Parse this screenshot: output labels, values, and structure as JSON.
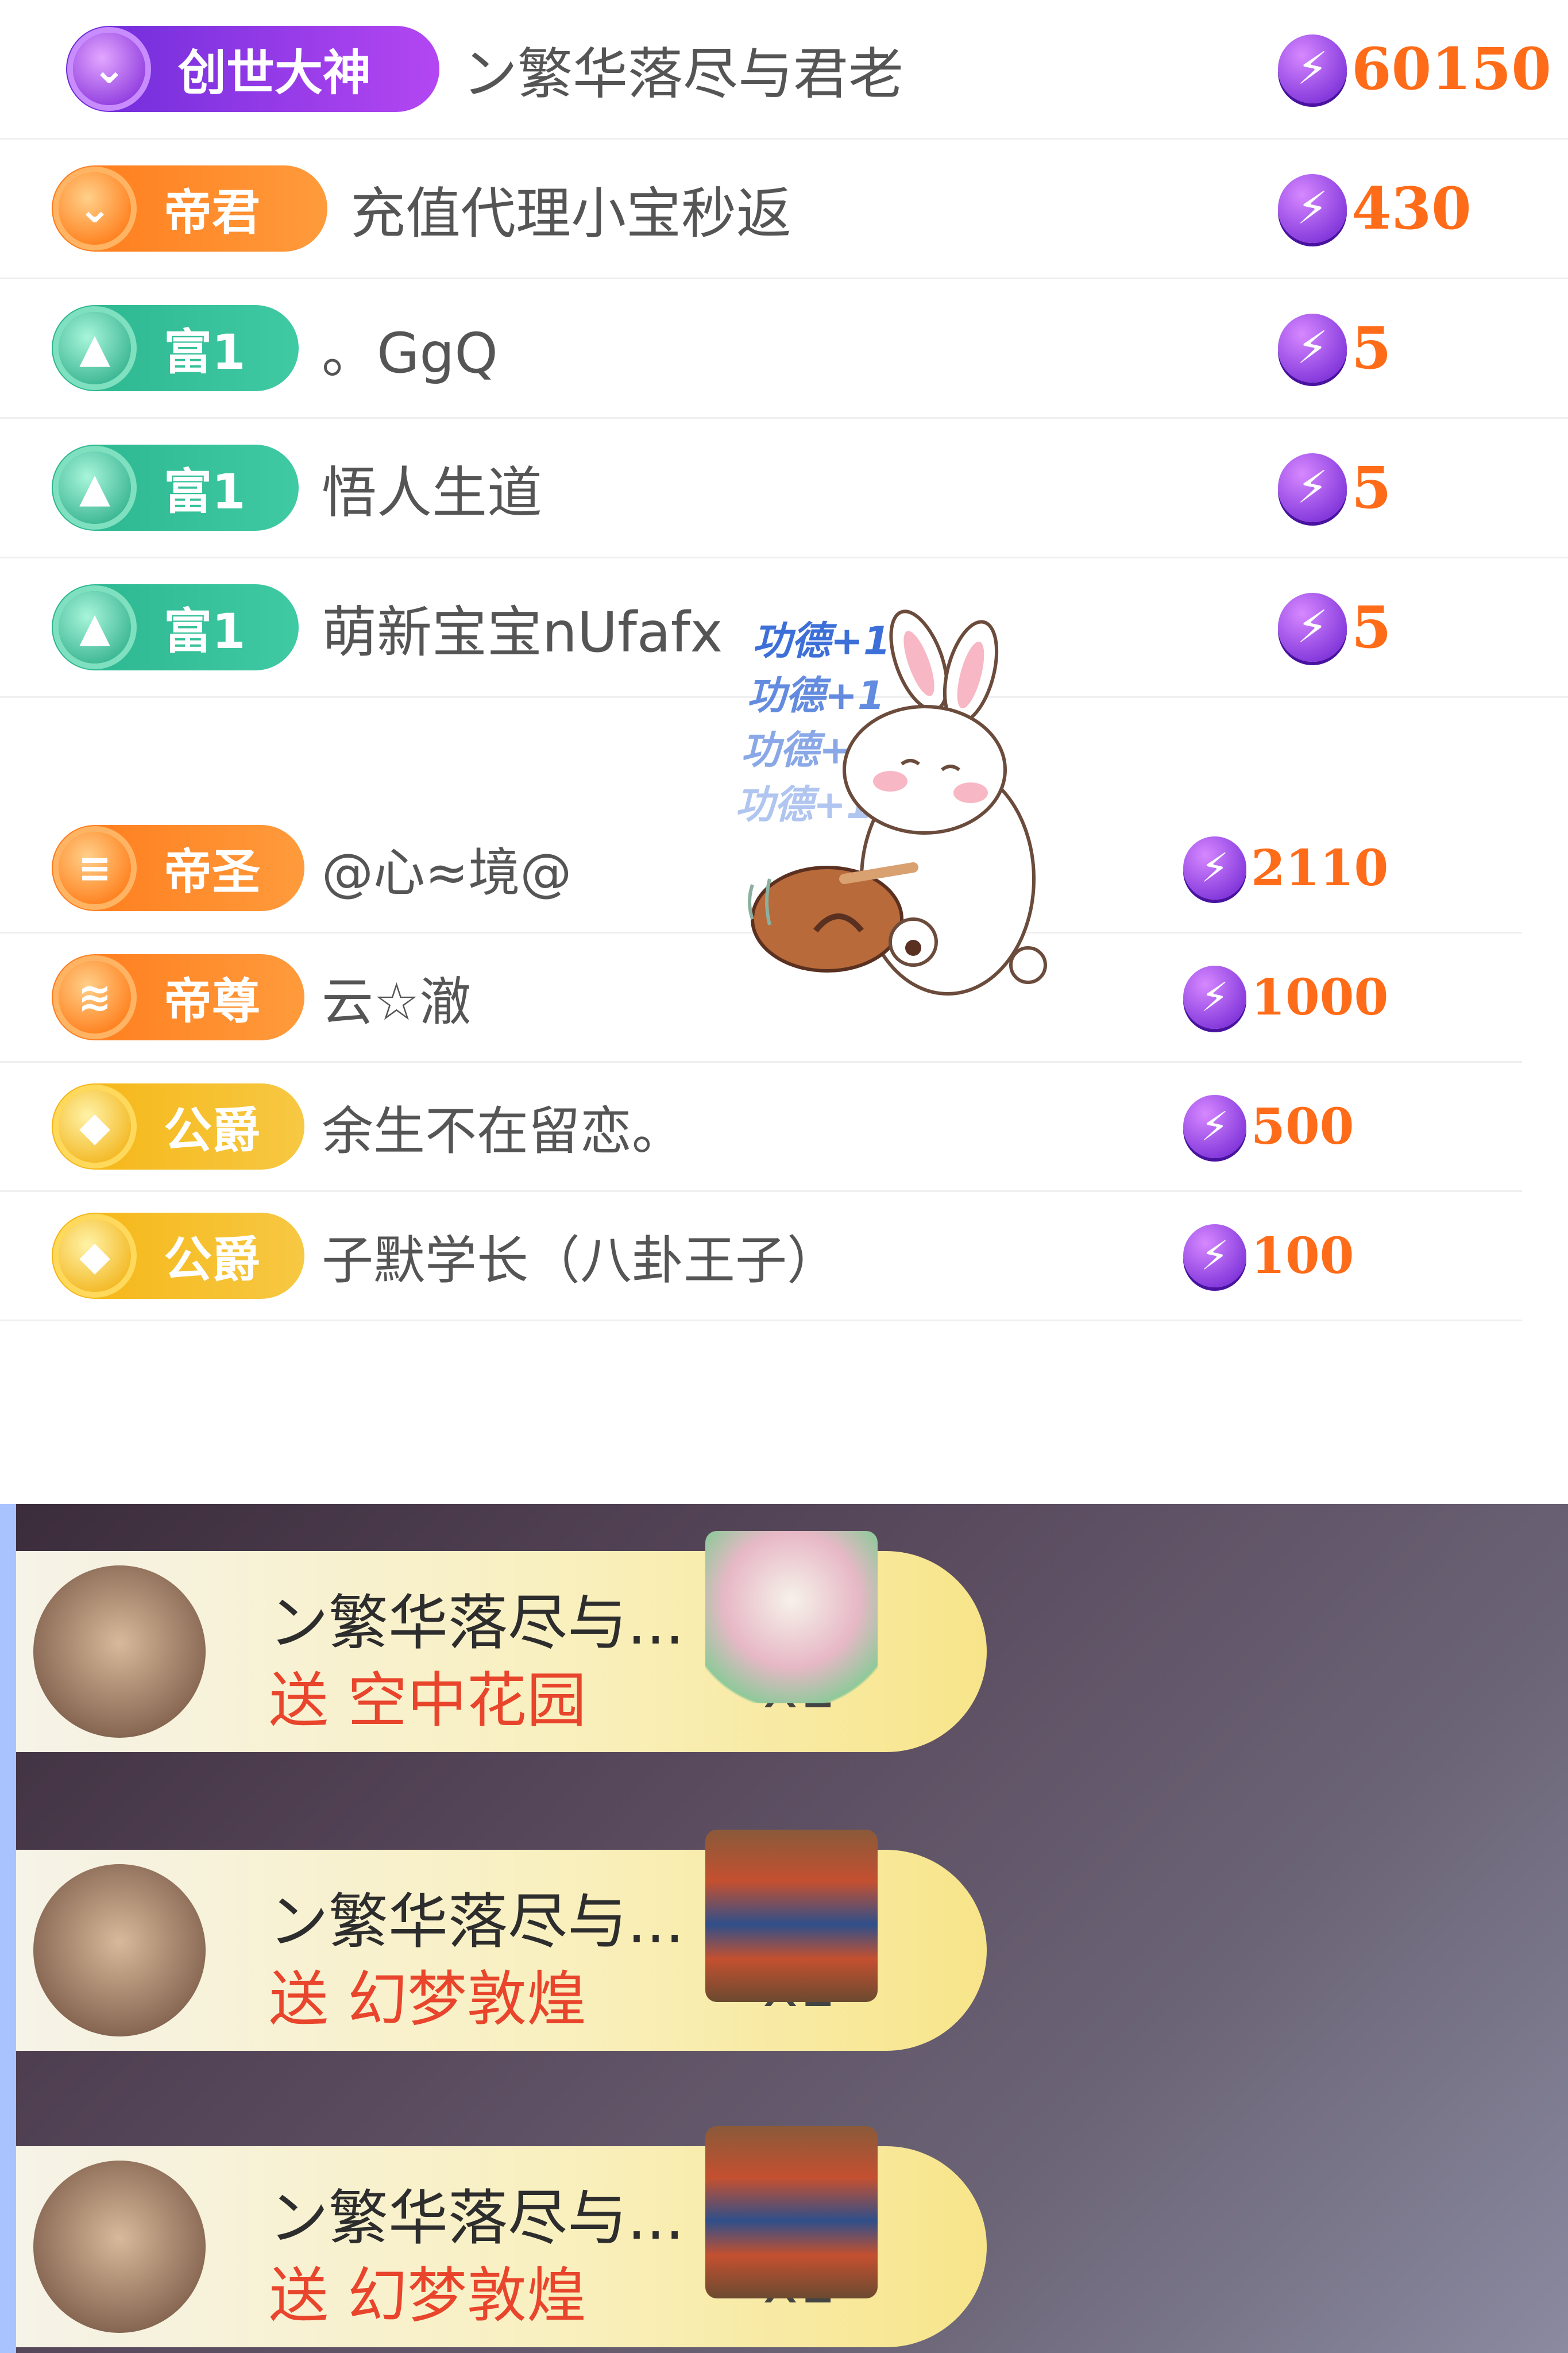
{
  "top_list": [
    {
      "badge": "创世大神",
      "badge_style": "purple",
      "name": "ン繁华落尽与君老",
      "amount": "60150"
    },
    {
      "badge": "帝君",
      "badge_style": "orange",
      "name": "充值代理小宝秒返",
      "amount": "430"
    },
    {
      "badge": "富1",
      "badge_style": "teal",
      "name": "。GgQ",
      "amount": "5"
    },
    {
      "badge": "富1",
      "badge_style": "teal",
      "name": "悟人生道",
      "amount": "5"
    },
    {
      "badge": "富1",
      "badge_style": "teal",
      "name": "萌新宝宝nUfafx",
      "amount": "5"
    }
  ],
  "second_list": [
    {
      "badge": "帝圣",
      "badge_style": "orange2",
      "name": "@心≈境@",
      "amount": "2110"
    },
    {
      "badge": "帝尊",
      "badge_style": "orange2",
      "name": "云☆澈",
      "amount": "1000"
    },
    {
      "badge": "公爵",
      "badge_style": "gold",
      "name": "余生不在留恋。",
      "amount": "500"
    },
    {
      "badge": "公爵",
      "badge_style": "gold",
      "name": "子默学长（八卦王子）",
      "amount": "100"
    }
  ],
  "sticker": {
    "merit_text": [
      "功德+1",
      "功德+1",
      "功德+1",
      "功德+1"
    ]
  },
  "gift_messages": [
    {
      "sender": "ン繁华落尽与...",
      "action": "送 空中花园",
      "count": "x1",
      "gift_icon": "sky-garden"
    },
    {
      "sender": "ン繁华落尽与...",
      "action": "送 幻梦敦煌",
      "count": "x1",
      "gift_icon": "dunhuang-tower"
    },
    {
      "sender": "ン繁华落尽与...",
      "action": "送 幻梦敦煌",
      "count": "x1",
      "gift_icon": "dunhuang-tower"
    }
  ],
  "colors": {
    "amount": "#ff6c19",
    "gift_action": "#e8452c",
    "bolt": "#7b22d6"
  }
}
